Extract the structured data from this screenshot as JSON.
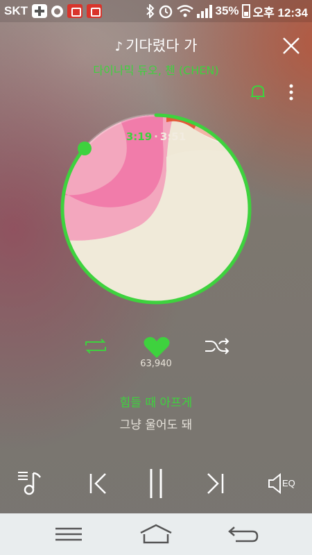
{
  "status_bar": {
    "carrier": "SKT",
    "battery": "35%",
    "time": "오후 12:34"
  },
  "player": {
    "title_icon": "sound-note-icon",
    "title": "기다렸다 가",
    "artist": "다이나믹 듀오, 첸 (CHEN)",
    "elapsed": "3:19",
    "separator": "·",
    "total": "3:51",
    "progress": 0.862,
    "like_count": "63,940",
    "lyric_current": "힘들 때 아프게",
    "lyric_next": "그냥 울어도 돼",
    "eq_label": "EQ"
  },
  "colors": {
    "accent": "#3ed23e",
    "navbar_bg": "#e9edee"
  },
  "icons": {
    "close": "close-icon",
    "bell": "bell-icon",
    "more": "more-vertical-icon",
    "repeat": "repeat-icon",
    "like": "heart-icon",
    "shuffle": "shuffle-icon",
    "playlist": "playlist-icon",
    "prev": "previous-track-icon",
    "pause": "pause-icon",
    "next": "next-track-icon",
    "eq": "equalizer-icon",
    "nav_menu": "menu-icon",
    "nav_home": "home-icon",
    "nav_back": "back-icon"
  }
}
